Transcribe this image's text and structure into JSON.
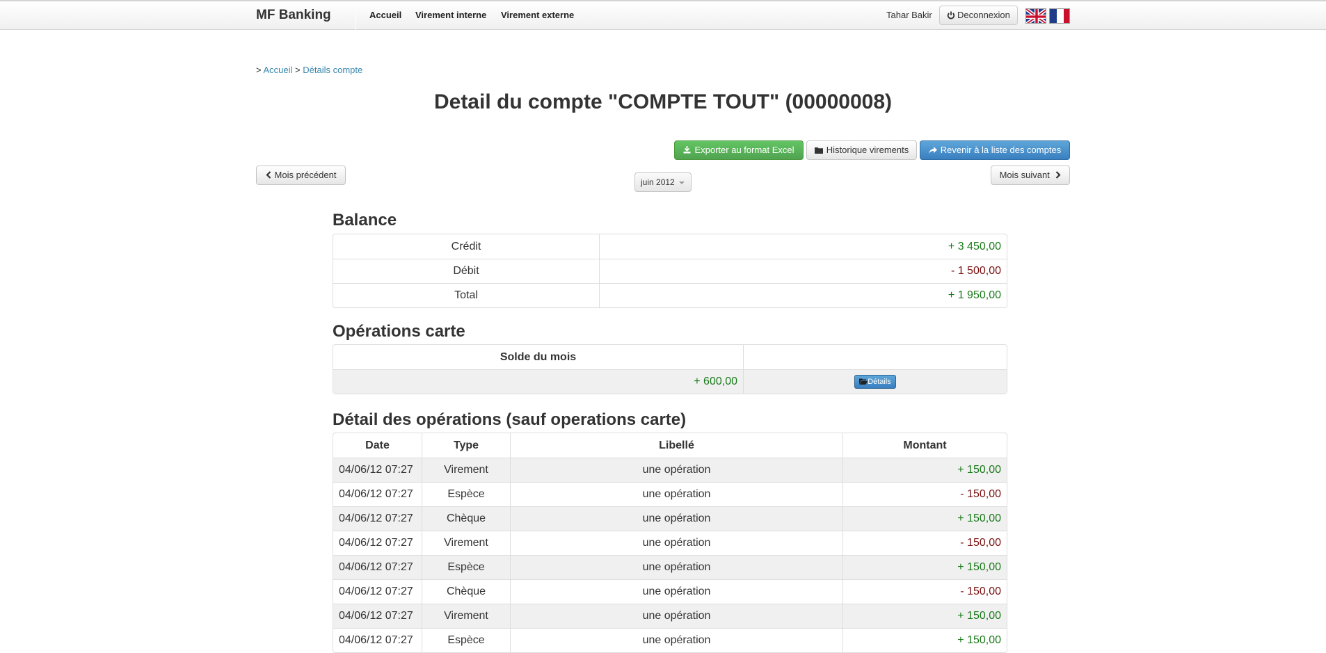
{
  "navbar": {
    "brand": "MF Banking",
    "links": [
      "Accueil",
      "Virement interne",
      "Virement externe"
    ],
    "user": "Tahar Bakir",
    "logout_label": "Deconnexion"
  },
  "breadcrumb": {
    "sep1": ">",
    "home": "Accueil",
    "sep2": ">",
    "current": "Détails compte"
  },
  "title": "Detail du compte \"COMPTE TOUT\" (00000008)",
  "toolbar": {
    "export_label": "Exporter au format Excel",
    "history_label": "Historique virements",
    "back_label": "Revenir à la liste des comptes"
  },
  "month_nav": {
    "prev_label": "Mois précédent",
    "next_label": "Mois suivant",
    "selected_month": "juin 2012"
  },
  "balance": {
    "title": "Balance",
    "rows": [
      {
        "label": "Crédit",
        "value": "+ 3 450,00",
        "sign": "pos"
      },
      {
        "label": "Débit",
        "value": "- 1 500,00",
        "sign": "neg"
      },
      {
        "label": "Total",
        "value": "+ 1 950,00",
        "sign": "pos"
      }
    ]
  },
  "card_ops": {
    "title": "Opérations carte",
    "header": "Solde du mois",
    "value": "+ 600,00",
    "details_label": "Détails"
  },
  "operations": {
    "title": "Détail des opérations (sauf operations carte)",
    "columns": [
      "Date",
      "Type",
      "Libellé",
      "Montant"
    ],
    "rows": [
      {
        "date": "04/06/12 07:27",
        "type": "Virement",
        "label": "une opération",
        "amount": "+ 150,00",
        "sign": "pos"
      },
      {
        "date": "04/06/12 07:27",
        "type": "Espèce",
        "label": "une opération",
        "amount": "- 150,00",
        "sign": "neg"
      },
      {
        "date": "04/06/12 07:27",
        "type": "Chèque",
        "label": "une opération",
        "amount": "+ 150,00",
        "sign": "pos"
      },
      {
        "date": "04/06/12 07:27",
        "type": "Virement",
        "label": "une opération",
        "amount": "- 150,00",
        "sign": "neg"
      },
      {
        "date": "04/06/12 07:27",
        "type": "Espèce",
        "label": "une opération",
        "amount": "+ 150,00",
        "sign": "pos"
      },
      {
        "date": "04/06/12 07:27",
        "type": "Chèque",
        "label": "une opération",
        "amount": "- 150,00",
        "sign": "neg"
      },
      {
        "date": "04/06/12 07:27",
        "type": "Virement",
        "label": "une opération",
        "amount": "+ 150,00",
        "sign": "pos"
      },
      {
        "date": "04/06/12 07:27",
        "type": "Espèce",
        "label": "une opération",
        "amount": "+ 150,00",
        "sign": "pos"
      }
    ]
  },
  "colors": {
    "positive": "#1a7a1a",
    "negative": "#7a1010",
    "link": "#3a87ad"
  },
  "icons": [
    "power-icon",
    "uk-flag-icon",
    "fr-flag-icon",
    "download-icon",
    "folder-icon",
    "share-arrow-icon",
    "chevron-left-icon",
    "chevron-right-icon",
    "caret-down-icon",
    "folder-open-icon"
  ]
}
